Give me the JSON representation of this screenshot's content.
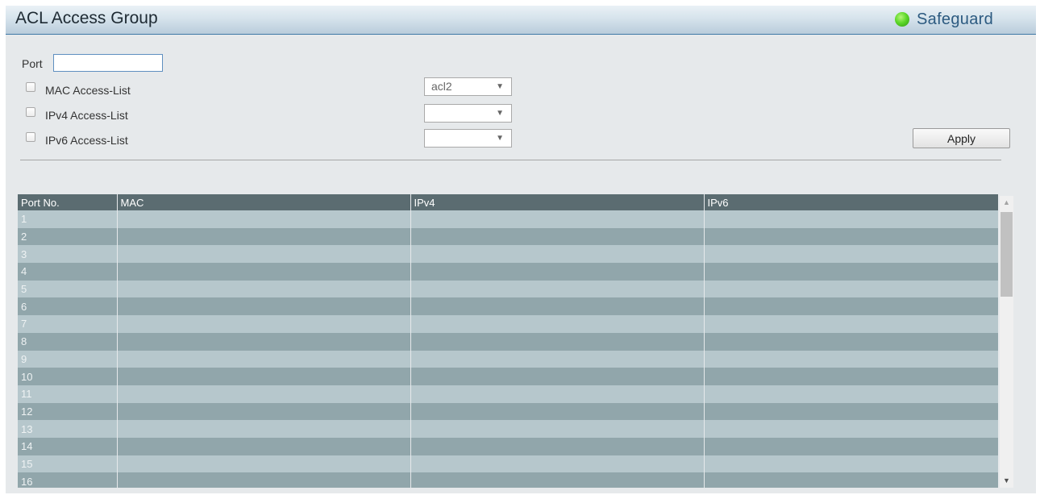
{
  "header": {
    "title": "ACL Access Group",
    "safeguard_label": "Safeguard",
    "safeguard_status_color": "#49c41d"
  },
  "form": {
    "port_label": "Port",
    "port_value": "",
    "mac": {
      "label": "MAC Access-List",
      "checked": false,
      "selected": "acl2"
    },
    "ipv4": {
      "label": "IPv4 Access-List",
      "checked": false,
      "selected": ""
    },
    "ipv6": {
      "label": "IPv6 Access-List",
      "checked": false,
      "selected": ""
    },
    "apply_label": "Apply"
  },
  "table": {
    "headers": [
      "Port No.",
      "MAC",
      "IPv4",
      "IPv6"
    ],
    "rows": [
      [
        "1",
        "",
        "",
        ""
      ],
      [
        "2",
        "",
        "",
        ""
      ],
      [
        "3",
        "",
        "",
        ""
      ],
      [
        "4",
        "",
        "",
        ""
      ],
      [
        "5",
        "",
        "",
        ""
      ],
      [
        "6",
        "",
        "",
        ""
      ],
      [
        "7",
        "",
        "",
        ""
      ],
      [
        "8",
        "",
        "",
        ""
      ],
      [
        "9",
        "",
        "",
        ""
      ],
      [
        "10",
        "",
        "",
        ""
      ],
      [
        "11",
        "",
        "",
        ""
      ],
      [
        "12",
        "",
        "",
        ""
      ],
      [
        "13",
        "",
        "",
        ""
      ],
      [
        "14",
        "",
        "",
        ""
      ],
      [
        "15",
        "",
        "",
        ""
      ],
      [
        "16",
        "",
        "",
        ""
      ]
    ]
  }
}
